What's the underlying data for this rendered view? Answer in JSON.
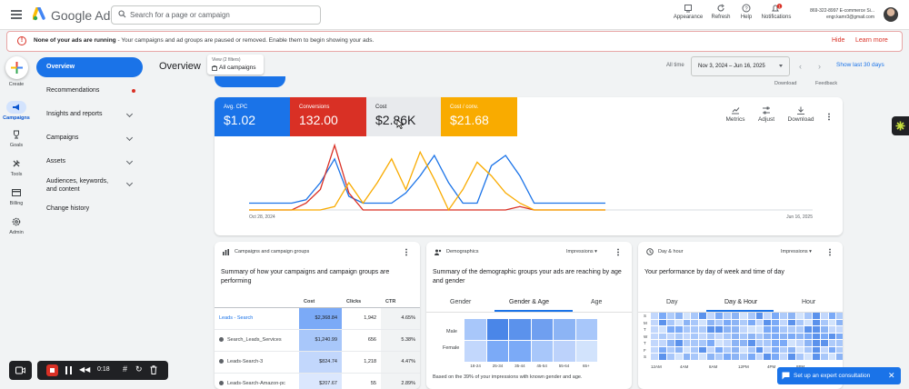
{
  "topbar": {
    "app_name": "Google Ads",
    "search_placeholder": "Search for a page or campaign",
    "buttons": [
      {
        "label": "Appearance",
        "icon": "appearance-icon"
      },
      {
        "label": "Refresh",
        "icon": "refresh-icon"
      },
      {
        "label": "Help",
        "icon": "help-icon"
      },
      {
        "label": "Notifications",
        "icon": "bell-icon",
        "badge": "1"
      }
    ],
    "account_line1": "869-322-8997 E-commerce Si...",
    "account_line2": "engr.kamr3@gmail.com"
  },
  "alert": {
    "bold": "None of your ads are running",
    "text": " - Your campaigns and ad groups are paused or removed. Enable them to begin showing your ads.",
    "hide": "Hide",
    "learn_more": "Learn more"
  },
  "rail": [
    {
      "label": "Create"
    },
    {
      "label": "Campaigns"
    },
    {
      "label": "Goals"
    },
    {
      "label": "Tools"
    },
    {
      "label": "Billing"
    },
    {
      "label": "Admin"
    }
  ],
  "nav": [
    {
      "label": "Overview"
    },
    {
      "label": "Recommendations"
    },
    {
      "label": "Insights and reports"
    },
    {
      "label": "Campaigns"
    },
    {
      "label": "Assets"
    },
    {
      "label": "Audiences, keywords, and content"
    },
    {
      "label": "Change history"
    }
  ],
  "header": {
    "title": "Overview",
    "view_label": "View (2 filters)",
    "view_value": "All campaigns",
    "all_time": "All time",
    "date_range": "Nov 3, 2024 – Jun 16, 2025",
    "show_last": "Show last 30 days",
    "download": "Download",
    "feedback": "Feedback"
  },
  "metrics": [
    {
      "label": "Avg. CPC",
      "value": "$1.02",
      "color": "#1a73e8"
    },
    {
      "label": "Conversions",
      "value": "132.00",
      "color": "#d93025"
    },
    {
      "label": "Cost",
      "value": "$2.86K",
      "color": "#e8eaed"
    },
    {
      "label": "Cost / conv.",
      "value": "$21.68",
      "color": "#f9ab00"
    }
  ],
  "tools": {
    "metrics": "Metrics",
    "adjust": "Adjust",
    "download": "Download"
  },
  "chart_data": {
    "type": "line",
    "x_start_label": "Oct 28, 2024",
    "x_end_label": "Jun 16, 2025",
    "series": [
      {
        "color": "#1a73e8",
        "values": [
          0.9,
          0.9,
          0.9,
          0.9,
          0.85,
          0.6,
          0.25,
          0.8,
          0.9,
          0.9,
          0.9,
          0.75,
          0.5,
          0.2,
          0.6,
          0.9,
          0.9,
          0.35,
          0.2,
          0.5,
          0.9,
          0.9,
          0.9,
          0.9,
          0.9,
          0.9
        ]
      },
      {
        "color": "#d93025",
        "values": [
          1,
          1,
          1,
          1,
          0.9,
          0.7,
          0.05,
          0.75,
          1,
          1,
          1,
          1,
          1,
          1,
          1,
          1,
          1,
          1,
          1,
          0.95,
          1,
          1,
          1,
          1,
          1,
          1
        ]
      },
      {
        "color": "#f9ab00",
        "values": [
          1,
          1,
          1,
          1,
          1,
          1,
          0.95,
          0.6,
          0.9,
          0.6,
          0.25,
          0.7,
          0.15,
          0.55,
          1,
          0.7,
          0.3,
          0.5,
          0.75,
          0.9,
          1,
          1,
          1,
          1,
          1,
          1
        ]
      }
    ]
  },
  "campaigns_card": {
    "title": "Campaigns and campaign groups",
    "desc": "Summary of how your campaigns and campaign groups are performing",
    "headers": [
      "",
      "Cost",
      "Clicks",
      "CTR"
    ],
    "rows": [
      {
        "name": "Leads - Search",
        "cost": "$2,368.84",
        "clicks": "1,942",
        "ctr": "4.65%",
        "shade": "#7baaf7"
      },
      {
        "name": "Search_Leads_Services",
        "cost": "$1,240.99",
        "clicks": "656",
        "ctr": "5.38%",
        "shade": "#a8c7fa"
      },
      {
        "name": "Leads-Search-3",
        "cost": "$824.74",
        "clicks": "1,218",
        "ctr": "4.47%",
        "shade": "#c2d7fc"
      },
      {
        "name": "Leads-Search-Amazon-pc",
        "cost": "$207.67",
        "clicks": "55",
        "ctr": "2.89%",
        "shade": "#dbe7fd"
      }
    ]
  },
  "demo_card": {
    "title": "Demographics",
    "dropdown": "Impressions",
    "desc": "Summary of the demographic groups your ads are reaching by age and gender",
    "tabs": [
      "Gender",
      "Gender & Age",
      "Age"
    ],
    "rows": [
      "Male",
      "Female"
    ],
    "ages": [
      "18-24",
      "25-34",
      "35-44",
      "45-54",
      "55-64",
      "65+"
    ],
    "footnote": "Based on the 39% of your impressions with known gender and age."
  },
  "day_card": {
    "title": "Day & hour",
    "dropdown": "Impressions",
    "desc": "Your performance by day of week and time of day",
    "tabs": [
      "Day",
      "Day & Hour",
      "Hour"
    ],
    "days": [
      "S",
      "M",
      "T",
      "W",
      "T",
      "F",
      "S"
    ],
    "hours": [
      "12AM",
      "4AM",
      "8AM",
      "12PM",
      "4PM",
      "8PM"
    ]
  },
  "recorder": {
    "time": "0:18"
  },
  "expert": {
    "label": "Set up an expert consultation"
  }
}
